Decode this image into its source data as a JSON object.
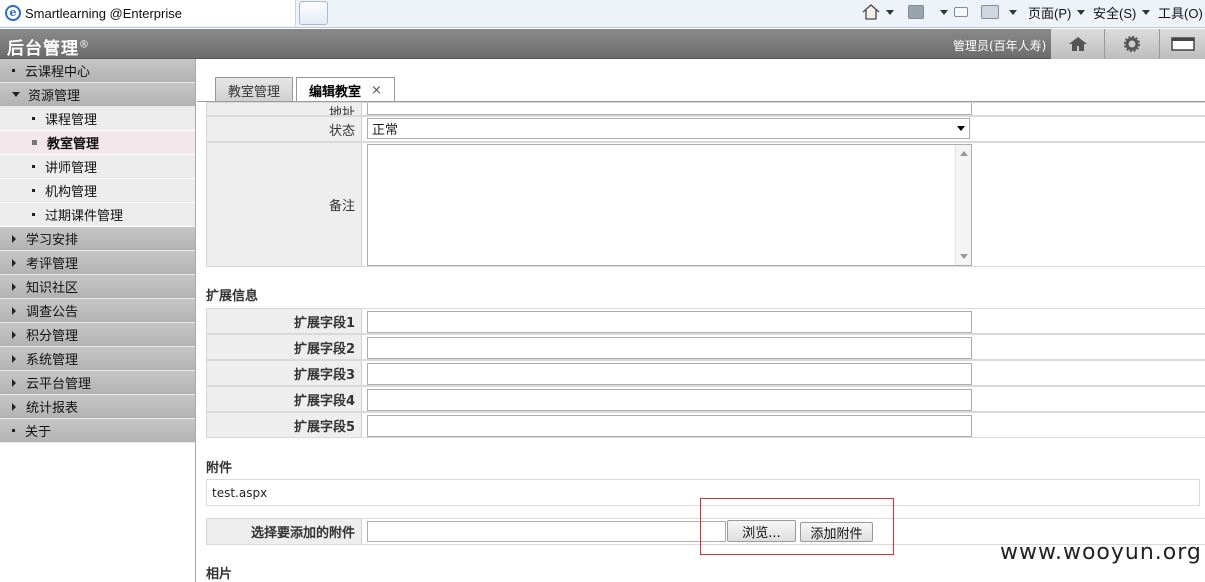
{
  "browser": {
    "tab_title": "Smartlearning @Enterprise",
    "menu": {
      "page": "页面(P)",
      "safety": "安全(S)",
      "tools": "工具(O)"
    }
  },
  "header": {
    "title": "后台管理",
    "registered_mark": "®",
    "admin_label": "管理员(百年人寿)"
  },
  "sidebar": {
    "items": [
      {
        "label": "云课程中心"
      },
      {
        "label": "资源管理"
      },
      {
        "label": "课程管理"
      },
      {
        "label": "教室管理"
      },
      {
        "label": "讲师管理"
      },
      {
        "label": "机构管理"
      },
      {
        "label": "过期课件管理"
      },
      {
        "label": "学习安排"
      },
      {
        "label": "考评管理"
      },
      {
        "label": "知识社区"
      },
      {
        "label": "调查公告"
      },
      {
        "label": "积分管理"
      },
      {
        "label": "系统管理"
      },
      {
        "label": "云平台管理"
      },
      {
        "label": "统计报表"
      },
      {
        "label": "关于"
      }
    ]
  },
  "tabs": {
    "classroom": "教室管理",
    "edit": "编辑教室",
    "close": "×"
  },
  "form": {
    "address_label": "地址",
    "status_label": "状态",
    "status_value": "正常",
    "remark_label": "备注",
    "ext_section": "扩展信息",
    "ext_fields": [
      "扩展字段1",
      "扩展字段2",
      "扩展字段3",
      "扩展字段4",
      "扩展字段5"
    ],
    "attach_section": "附件",
    "attach_file": "test.aspx",
    "select_attach_label": "选择要添加的附件",
    "browse_button": "浏览...",
    "add_attach_button": "添加附件",
    "photo_section": "相片"
  },
  "watermark": "www.wooyun.org"
}
